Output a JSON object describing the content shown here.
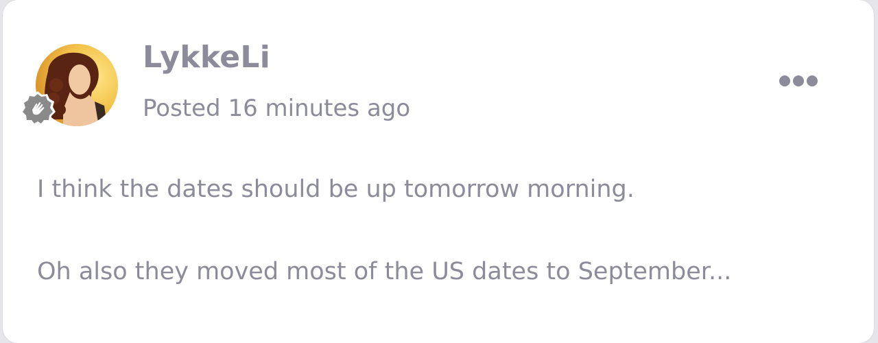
{
  "post": {
    "username": "LykkeLi",
    "posted": "Posted 16 minutes ago",
    "paragraphs": [
      "I think the dates should be up tomorrow morning.",
      "Oh also they moved most of the US dates to September..."
    ]
  },
  "icons": {
    "avatar": "user-avatar-photo",
    "badge": "hand-wave-badge-icon",
    "more": "more-horizontal-icon"
  },
  "colors": {
    "text": "#8b8b99",
    "card": "#ffffff",
    "badge": "#8a8a8a"
  }
}
